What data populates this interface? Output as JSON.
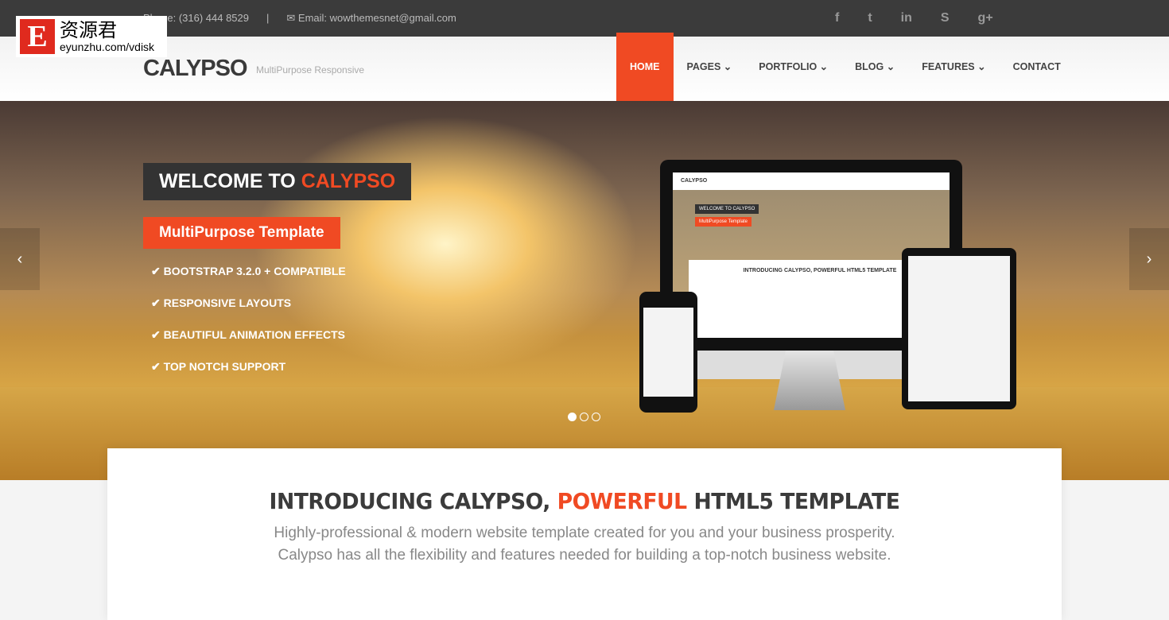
{
  "topbar": {
    "phone": "Phone: (316) 444 8529",
    "separator": "|",
    "email": "Email: wowthemesnet@gmail.com",
    "social": [
      {
        "icon": "facebook-icon",
        "glyph": "f"
      },
      {
        "icon": "twitter-icon",
        "glyph": "t"
      },
      {
        "icon": "linkedin-icon",
        "glyph": "in"
      },
      {
        "icon": "skype-icon",
        "glyph": "S"
      },
      {
        "icon": "google-plus-icon",
        "glyph": "g+"
      }
    ]
  },
  "header": {
    "logo": "CALYPSO",
    "tagline": "MultiPurpose Responsive",
    "nav": [
      {
        "label": "HOME"
      },
      {
        "label": "PAGES ⌄"
      },
      {
        "label": "PORTFOLIO ⌄"
      },
      {
        "label": "BLOG ⌄"
      },
      {
        "label": "FEATURES ⌄"
      },
      {
        "label": "CONTACT"
      }
    ]
  },
  "hero": {
    "welcome": "WELCOME TO ",
    "welcome_accent": "CALYPSO",
    "subtitle": "MultiPurpose Template",
    "features": [
      "✔ BOOTSTRAP 3.2.0 + COMPATIBLE",
      "✔ RESPONSIVE LAYOUTS",
      "✔ BEAUTIFUL ANIMATION EFFECTS",
      "✔ TOP NOTCH SUPPORT"
    ],
    "prev": "‹",
    "next": "›",
    "active_slide": 1,
    "slide_count": 3,
    "mockup": {
      "logo": "CALYPSO",
      "welcome": "WELCOME TO CALYPSO",
      "subtitle": "MultiPurpose Template",
      "intro": "INTRODUCING CALYPSO, POWERFUL HTML5 TEMPLATE"
    }
  },
  "intro": {
    "title_a": "INTRODUCING CALYPSO, ",
    "title_accent": "POWERFUL",
    "title_b": " HTML5 TEMPLATE",
    "line1": "Highly-professional & modern website template created for you and your business prosperity.",
    "line2": "Calypso has all the flexibility and features needed for building a top-notch business website."
  },
  "watermark": {
    "letter": "E",
    "name": "资源君",
    "url": "eyunzhu.com/vdisk"
  },
  "colors": {
    "accent": "#f04a23",
    "topbar": "#3b3b3b"
  }
}
